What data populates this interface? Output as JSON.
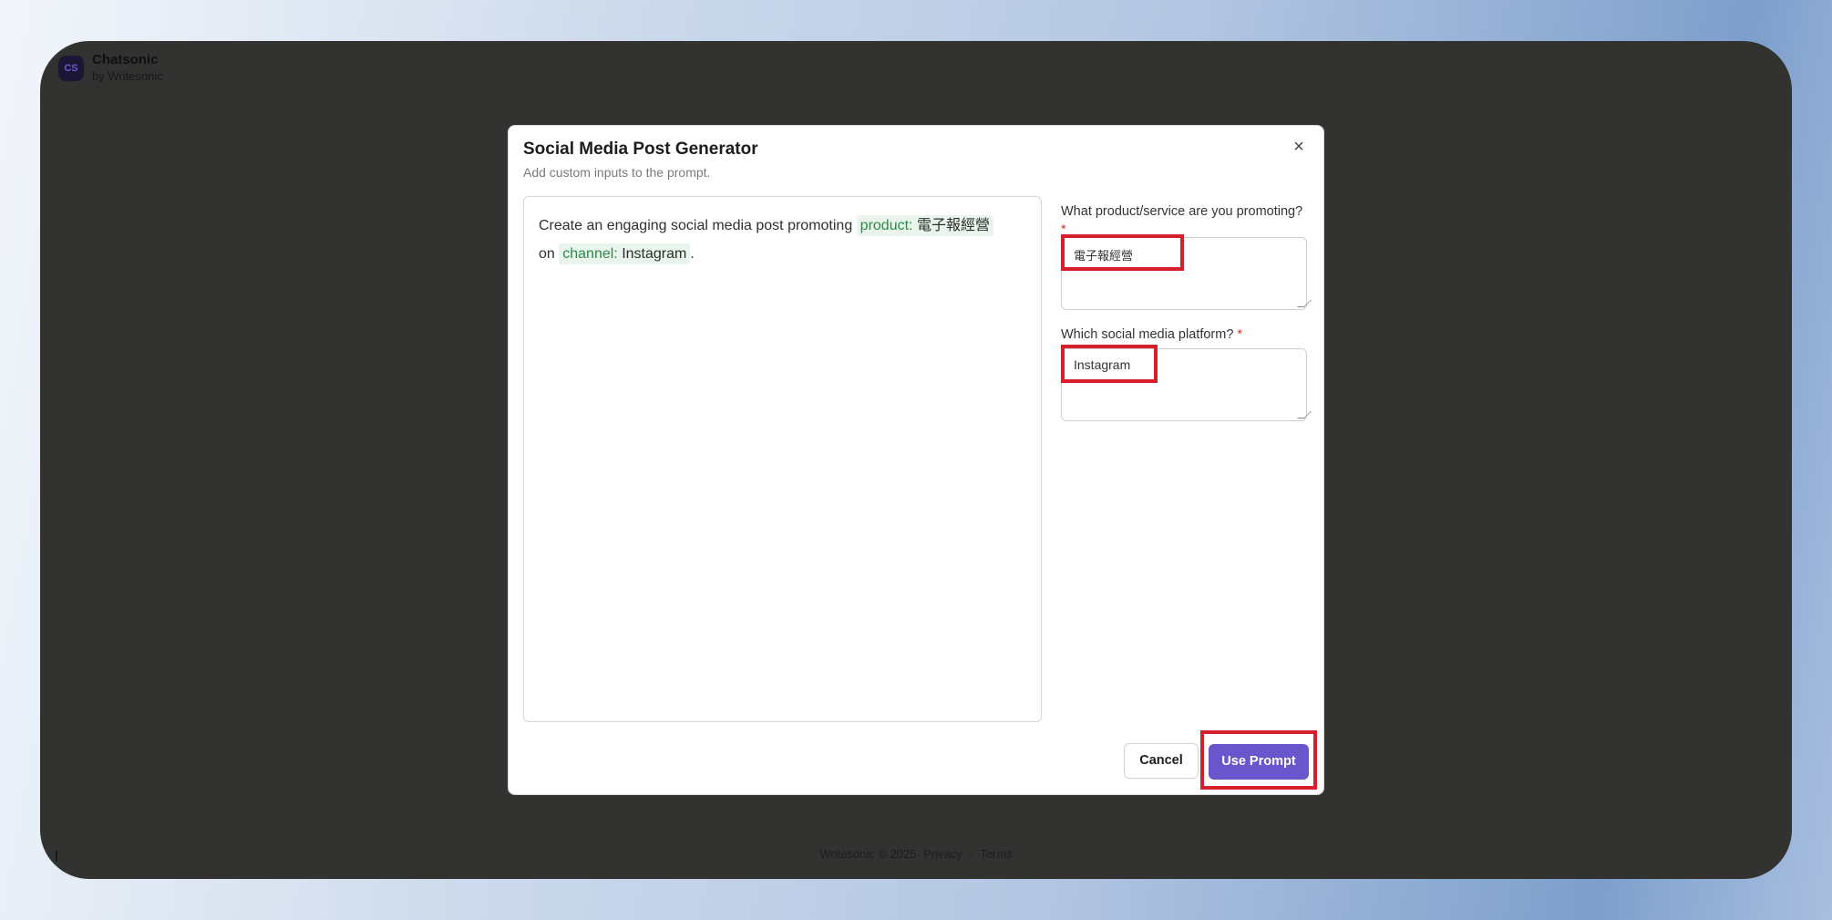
{
  "app": {
    "logo_text": "CS",
    "name": "Chatsonic",
    "subtitle": "by Writesonic"
  },
  "footer": {
    "copyright": "Writesonic © 2025",
    "privacy": "Privacy",
    "separator": "·",
    "terms": "Terms"
  },
  "modal": {
    "title": "Social Media Post Generator",
    "subtitle": "Add custom inputs to the prompt.",
    "close_glyph": "×",
    "prompt": {
      "text_before": "Create an engaging social media post promoting",
      "var1_key": "product:",
      "var1_value": "電子報經營",
      "text_middle": "on",
      "var2_key": "channel:",
      "var2_value": "Instagram",
      "text_end": "."
    },
    "fields": [
      {
        "label": "What product/service are you promoting?",
        "required_mark": "*",
        "value": "電子報經營"
      },
      {
        "label": "Which social media platform?",
        "required_mark": "*",
        "value": "Instagram"
      }
    ],
    "cancel_label": "Cancel",
    "use_prompt_label": "Use Prompt"
  },
  "colors": {
    "accent": "#6a56cc",
    "highlight": "#d51f2a",
    "variable_chip": "#e9f5ec",
    "variable_key": "#2e8a49",
    "backdrop": "#323231"
  },
  "icons": {
    "close": "close-icon",
    "resize": "resize-handle-icon"
  }
}
